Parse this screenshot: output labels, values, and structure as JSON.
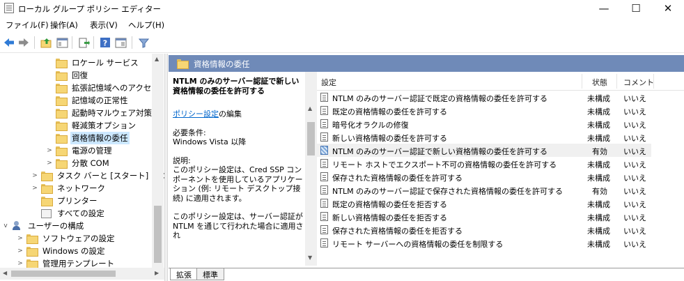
{
  "window": {
    "title": "ローカル グループ ポリシー エディター",
    "minimize_glyph": "—",
    "maximize_glyph": "☐",
    "close_glyph": "✕"
  },
  "menu": {
    "file": "ファイル(F)",
    "action": "操作(A)",
    "view": "表示(V)",
    "help": "ヘルプ(H)"
  },
  "toolbar": {
    "icons": [
      "back-icon",
      "forward-icon",
      "up-folder-icon",
      "show-hide-tree-icon",
      "export-list-icon",
      "help-icon",
      "extended-view-icon",
      "filter-icon"
    ]
  },
  "tree": {
    "items": [
      {
        "label": "ロケール サービス",
        "type": "folder"
      },
      {
        "label": "回復",
        "type": "folder"
      },
      {
        "label": "拡張記憶域へのアクセス",
        "type": "folder"
      },
      {
        "label": "記憶域の正常性",
        "type": "folder"
      },
      {
        "label": "起動時マルウェア対策",
        "type": "folder"
      },
      {
        "label": "軽減策オプション",
        "type": "folder"
      },
      {
        "label": "資格情報の委任",
        "type": "folder",
        "selected": true
      },
      {
        "label": "電源の管理",
        "type": "folder",
        "expandable": true
      },
      {
        "label": "分散 COM",
        "type": "folder",
        "expandable": true
      },
      {
        "label": "タスク バーと [スタート] メニュー",
        "type": "folder",
        "expandable": true
      },
      {
        "label": "ネットワーク",
        "type": "folder",
        "expandable": true
      },
      {
        "label": "プリンター",
        "type": "folder"
      },
      {
        "label": "すべての設定",
        "type": "settings"
      },
      {
        "label": "ユーザーの構成",
        "type": "user",
        "expanded": true
      },
      {
        "label": "ソフトウェアの設定",
        "type": "folder",
        "expandable": true
      },
      {
        "label": "Windows の設定",
        "type": "folder",
        "expandable": true
      },
      {
        "label": "管理用テンプレート",
        "type": "folder",
        "expandable": true
      }
    ]
  },
  "pane": {
    "header_title": "資格情報の委任"
  },
  "description": {
    "title": "NTLM のみのサーバー認証で新しい資格情報の委任を許可する",
    "edit_link": "ポリシー設定",
    "edit_suffix": "の編集",
    "requirements_label": "必要条件:",
    "requirements_value": "Windows Vista 以降",
    "explanation_label": "説明:",
    "explanation_1": "このポリシー設定は、Cred SSP コンポーネントを使用しているアプリケーション (例: リモート デスクトップ接続) に適用されます。",
    "explanation_2": "このポリシー設定は、サーバー認証が NTLM を通じて行われた場合に適用され"
  },
  "list": {
    "columns": {
      "setting": "設定",
      "state": "状態",
      "comment": "コメント"
    },
    "rows": [
      {
        "name": "NTLM のみのサーバー認証で既定の資格情報の委任を許可する",
        "state": "未構成",
        "comment": "いいえ"
      },
      {
        "name": "既定の資格情報の委任を許可する",
        "state": "未構成",
        "comment": "いいえ"
      },
      {
        "name": "暗号化オラクルの修復",
        "state": "未構成",
        "comment": "いいえ"
      },
      {
        "name": "新しい資格情報の委任を許可する",
        "state": "未構成",
        "comment": "いいえ"
      },
      {
        "name": "NTLM のみのサーバー認証で新しい資格情報の委任を許可する",
        "state": "有効",
        "comment": "いいえ",
        "enabled": true
      },
      {
        "name": "リモート ホストでエクスポート不可の資格情報の委任を許可する",
        "state": "未構成",
        "comment": "いいえ"
      },
      {
        "name": "保存された資格情報の委任を許可する",
        "state": "未構成",
        "comment": "いいえ"
      },
      {
        "name": "NTLM のみのサーバー認証で保存された資格情報の委任を許可する",
        "state": "有効",
        "comment": "いいえ",
        "enabled": true
      },
      {
        "name": "既定の資格情報の委任を拒否する",
        "state": "未構成",
        "comment": "いいえ"
      },
      {
        "name": "新しい資格情報の委任を拒否する",
        "state": "未構成",
        "comment": "いいえ"
      },
      {
        "name": "保存された資格情報の委任を拒否する",
        "state": "未構成",
        "comment": "いいえ"
      },
      {
        "name": "リモート サーバーへの資格情報の委任を制限する",
        "state": "未構成",
        "comment": "いいえ"
      }
    ]
  },
  "tabs": {
    "extended": "拡張",
    "standard": "標準"
  },
  "colors": {
    "header_bg": "#6f8ab8",
    "selection": "#cce8ff",
    "link": "#0066cc"
  }
}
